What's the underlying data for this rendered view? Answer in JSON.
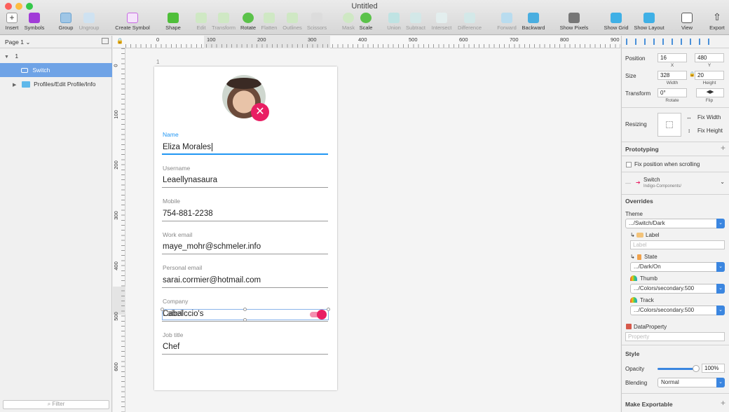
{
  "window": {
    "title": "Untitled"
  },
  "toolbar": {
    "insert": "Insert",
    "symbols": "Symbols",
    "group": "Group",
    "ungroup": "Ungroup",
    "create_symbol": "Create Symbol",
    "shape": "Shape",
    "edit": "Edit",
    "transform": "Transform",
    "rotate": "Rotate",
    "flatten": "Flatten",
    "outlines": "Outlines",
    "scissors": "Scissors",
    "mask": "Mask",
    "scale": "Scale",
    "union": "Union",
    "subtract": "Subtract",
    "intersect": "Intersect",
    "difference": "Difference",
    "forward": "Forward",
    "backward": "Backward",
    "show_pixels": "Show Pixels",
    "show_grid": "Show Grid",
    "show_layout": "Show Layout",
    "view": "View",
    "export": "Export"
  },
  "sidebar": {
    "page": "Page 1",
    "layers": [
      {
        "label": "1"
      },
      {
        "label": "Switch"
      },
      {
        "label": "Profiles/Edit Profile/Info"
      }
    ],
    "filter_placeholder": "Filter"
  },
  "rulers": {
    "top": [
      "0",
      "100",
      "200",
      "300",
      "400",
      "500",
      "600",
      "700",
      "800",
      "900"
    ],
    "left": [
      "0",
      "100",
      "200",
      "300",
      "400",
      "500",
      "600"
    ]
  },
  "artboard": {
    "label": "1",
    "fields": [
      {
        "label": "Name",
        "value": "Eliza Morales"
      },
      {
        "label": "Username",
        "value": "Leaellynasaura"
      },
      {
        "label": "Mobile",
        "value": "754-881-2238"
      },
      {
        "label": "Work email",
        "value": "maye_mohr@schmeler.info"
      },
      {
        "label": "Personal email",
        "value": "sarai.cormier@hotmail.com"
      },
      {
        "label": "Company",
        "value": "Cabalccio's"
      },
      {
        "label": "Job title",
        "value": "Chef"
      }
    ],
    "switch_overlay_label": "Label"
  },
  "inspector": {
    "position_label": "Position",
    "x": "16",
    "y": "480",
    "x_label": "X",
    "y_label": "Y",
    "size_label": "Size",
    "width": "328",
    "height": "20",
    "width_label": "Width",
    "height_label": "Height",
    "transform_label": "Transform",
    "rotate": "0°",
    "rotate_label": "Rotate",
    "flip_label": "Flip",
    "resizing_label": "Resizing",
    "fix_width": "Fix Width",
    "fix_height": "Fix Height",
    "prototyping": "Prototyping",
    "fix_position": "Fix position when scrolling",
    "symbol_name": "Switch",
    "symbol_lib": "Indigo-Components/",
    "overrides": "Overrides",
    "theme_label": "Theme",
    "theme_value": ".../Switch/Dark",
    "label_label": "Label",
    "label_placeholder": "Label",
    "state_label": "State",
    "state_value": ".../Dark/On",
    "thumb_label": "Thumb",
    "thumb_value": ".../Colors/secondary.500",
    "track_label": "Track",
    "track_value": ".../Colors/secondary.500",
    "dataproperty_label": "DataProperty",
    "property_placeholder": "Property",
    "style": "Style",
    "opacity_label": "Opacity",
    "opacity_value": "100%",
    "blending_label": "Blending",
    "blending_value": "Normal",
    "make_exportable": "Make Exportable"
  },
  "colors": {
    "accent": "#e91e63",
    "focus": "#2196f3",
    "selection": "#6fa3e6"
  }
}
